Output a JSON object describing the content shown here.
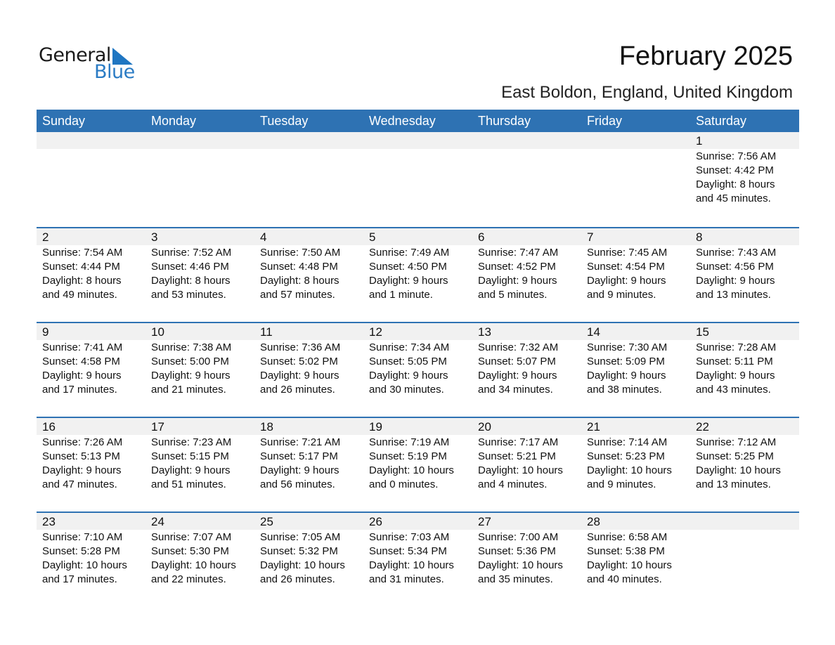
{
  "logo": {
    "line1": "General",
    "line2": "Blue",
    "accent_color": "#1f76c2"
  },
  "header": {
    "title": "February 2025",
    "location": "East Boldon, England, United Kingdom"
  },
  "weekdays": [
    "Sunday",
    "Monday",
    "Tuesday",
    "Wednesday",
    "Thursday",
    "Friday",
    "Saturday"
  ],
  "colors": {
    "header_bg": "#2e72b3",
    "day_number_bg": "#f1f1f1"
  },
  "weeks": [
    [
      null,
      null,
      null,
      null,
      null,
      null,
      {
        "day": "1",
        "sunrise": "Sunrise: 7:56 AM",
        "sunset": "Sunset: 4:42 PM",
        "daylight1": "Daylight: 8 hours",
        "daylight2": "and 45 minutes."
      }
    ],
    [
      {
        "day": "2",
        "sunrise": "Sunrise: 7:54 AM",
        "sunset": "Sunset: 4:44 PM",
        "daylight1": "Daylight: 8 hours",
        "daylight2": "and 49 minutes."
      },
      {
        "day": "3",
        "sunrise": "Sunrise: 7:52 AM",
        "sunset": "Sunset: 4:46 PM",
        "daylight1": "Daylight: 8 hours",
        "daylight2": "and 53 minutes."
      },
      {
        "day": "4",
        "sunrise": "Sunrise: 7:50 AM",
        "sunset": "Sunset: 4:48 PM",
        "daylight1": "Daylight: 8 hours",
        "daylight2": "and 57 minutes."
      },
      {
        "day": "5",
        "sunrise": "Sunrise: 7:49 AM",
        "sunset": "Sunset: 4:50 PM",
        "daylight1": "Daylight: 9 hours",
        "daylight2": "and 1 minute."
      },
      {
        "day": "6",
        "sunrise": "Sunrise: 7:47 AM",
        "sunset": "Sunset: 4:52 PM",
        "daylight1": "Daylight: 9 hours",
        "daylight2": "and 5 minutes."
      },
      {
        "day": "7",
        "sunrise": "Sunrise: 7:45 AM",
        "sunset": "Sunset: 4:54 PM",
        "daylight1": "Daylight: 9 hours",
        "daylight2": "and 9 minutes."
      },
      {
        "day": "8",
        "sunrise": "Sunrise: 7:43 AM",
        "sunset": "Sunset: 4:56 PM",
        "daylight1": "Daylight: 9 hours",
        "daylight2": "and 13 minutes."
      }
    ],
    [
      {
        "day": "9",
        "sunrise": "Sunrise: 7:41 AM",
        "sunset": "Sunset: 4:58 PM",
        "daylight1": "Daylight: 9 hours",
        "daylight2": "and 17 minutes."
      },
      {
        "day": "10",
        "sunrise": "Sunrise: 7:38 AM",
        "sunset": "Sunset: 5:00 PM",
        "daylight1": "Daylight: 9 hours",
        "daylight2": "and 21 minutes."
      },
      {
        "day": "11",
        "sunrise": "Sunrise: 7:36 AM",
        "sunset": "Sunset: 5:02 PM",
        "daylight1": "Daylight: 9 hours",
        "daylight2": "and 26 minutes."
      },
      {
        "day": "12",
        "sunrise": "Sunrise: 7:34 AM",
        "sunset": "Sunset: 5:05 PM",
        "daylight1": "Daylight: 9 hours",
        "daylight2": "and 30 minutes."
      },
      {
        "day": "13",
        "sunrise": "Sunrise: 7:32 AM",
        "sunset": "Sunset: 5:07 PM",
        "daylight1": "Daylight: 9 hours",
        "daylight2": "and 34 minutes."
      },
      {
        "day": "14",
        "sunrise": "Sunrise: 7:30 AM",
        "sunset": "Sunset: 5:09 PM",
        "daylight1": "Daylight: 9 hours",
        "daylight2": "and 38 minutes."
      },
      {
        "day": "15",
        "sunrise": "Sunrise: 7:28 AM",
        "sunset": "Sunset: 5:11 PM",
        "daylight1": "Daylight: 9 hours",
        "daylight2": "and 43 minutes."
      }
    ],
    [
      {
        "day": "16",
        "sunrise": "Sunrise: 7:26 AM",
        "sunset": "Sunset: 5:13 PM",
        "daylight1": "Daylight: 9 hours",
        "daylight2": "and 47 minutes."
      },
      {
        "day": "17",
        "sunrise": "Sunrise: 7:23 AM",
        "sunset": "Sunset: 5:15 PM",
        "daylight1": "Daylight: 9 hours",
        "daylight2": "and 51 minutes."
      },
      {
        "day": "18",
        "sunrise": "Sunrise: 7:21 AM",
        "sunset": "Sunset: 5:17 PM",
        "daylight1": "Daylight: 9 hours",
        "daylight2": "and 56 minutes."
      },
      {
        "day": "19",
        "sunrise": "Sunrise: 7:19 AM",
        "sunset": "Sunset: 5:19 PM",
        "daylight1": "Daylight: 10 hours",
        "daylight2": "and 0 minutes."
      },
      {
        "day": "20",
        "sunrise": "Sunrise: 7:17 AM",
        "sunset": "Sunset: 5:21 PM",
        "daylight1": "Daylight: 10 hours",
        "daylight2": "and 4 minutes."
      },
      {
        "day": "21",
        "sunrise": "Sunrise: 7:14 AM",
        "sunset": "Sunset: 5:23 PM",
        "daylight1": "Daylight: 10 hours",
        "daylight2": "and 9 minutes."
      },
      {
        "day": "22",
        "sunrise": "Sunrise: 7:12 AM",
        "sunset": "Sunset: 5:25 PM",
        "daylight1": "Daylight: 10 hours",
        "daylight2": "and 13 minutes."
      }
    ],
    [
      {
        "day": "23",
        "sunrise": "Sunrise: 7:10 AM",
        "sunset": "Sunset: 5:28 PM",
        "daylight1": "Daylight: 10 hours",
        "daylight2": "and 17 minutes."
      },
      {
        "day": "24",
        "sunrise": "Sunrise: 7:07 AM",
        "sunset": "Sunset: 5:30 PM",
        "daylight1": "Daylight: 10 hours",
        "daylight2": "and 22 minutes."
      },
      {
        "day": "25",
        "sunrise": "Sunrise: 7:05 AM",
        "sunset": "Sunset: 5:32 PM",
        "daylight1": "Daylight: 10 hours",
        "daylight2": "and 26 minutes."
      },
      {
        "day": "26",
        "sunrise": "Sunrise: 7:03 AM",
        "sunset": "Sunset: 5:34 PM",
        "daylight1": "Daylight: 10 hours",
        "daylight2": "and 31 minutes."
      },
      {
        "day": "27",
        "sunrise": "Sunrise: 7:00 AM",
        "sunset": "Sunset: 5:36 PM",
        "daylight1": "Daylight: 10 hours",
        "daylight2": "and 35 minutes."
      },
      {
        "day": "28",
        "sunrise": "Sunrise: 6:58 AM",
        "sunset": "Sunset: 5:38 PM",
        "daylight1": "Daylight: 10 hours",
        "daylight2": "and 40 minutes."
      },
      null
    ]
  ]
}
